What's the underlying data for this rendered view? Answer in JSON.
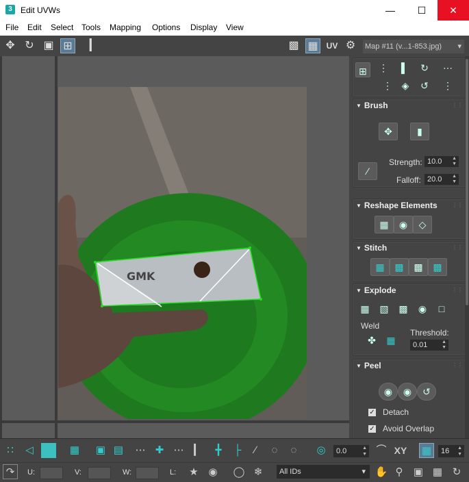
{
  "window": {
    "app_icon": "3",
    "title": "Edit UVWs",
    "minimize_icon": "minimize-icon",
    "maximize_icon": "maximize-icon",
    "close_icon": "close-icon"
  },
  "menu": [
    "File",
    "Edit",
    "Select",
    "Tools",
    "Mapping",
    "Options",
    "Display",
    "View"
  ],
  "toolbar": {
    "uv_label": "UV",
    "map_selector": "Map #11 (v...1-853.jpg)"
  },
  "panel": {
    "brush": {
      "title": "Brush",
      "strength_label": "Strength:",
      "strength_value": "10.0",
      "falloff_label": "Falloff:",
      "falloff_value": "20.0"
    },
    "reshape": {
      "title": "Reshape Elements"
    },
    "stitch": {
      "title": "Stitch"
    },
    "explode": {
      "title": "Explode",
      "weld_label": "Weld",
      "threshold_label": "Threshold:",
      "threshold_value": "0.01"
    },
    "peel": {
      "title": "Peel",
      "detach_label": "Detach",
      "detach_checked": true,
      "avoid_overlap_label": "Avoid Overlap",
      "avoid_overlap_checked": true
    }
  },
  "bottom": {
    "angle_value": "0.0",
    "xy_label": "XY",
    "grid_value": "16",
    "u_label": "U:",
    "v_label": "V:",
    "w_label": "W:",
    "l_label": "L:",
    "id_filter": "All IDs"
  },
  "colors": {
    "accent": "#3cc0c0",
    "uv_outline": "#22dd22",
    "close_button": "#e81123"
  }
}
